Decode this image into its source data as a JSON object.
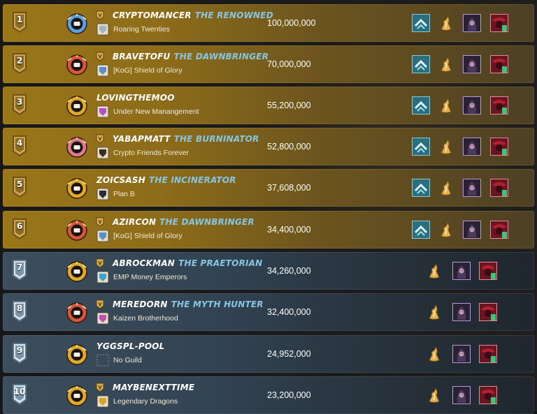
{
  "leaderboard": [
    {
      "rank": "1",
      "player": "CRYPTOMANCER",
      "title": "THE RENOWNED",
      "guild": "Roaring Twenties",
      "score": "100,000,000",
      "tier": "gold",
      "emblem": true,
      "has_title_icon": true
    },
    {
      "rank": "2",
      "player": "BRAVETOFU",
      "title": "THE DAWNBRINGER",
      "guild": "[KoG] Shield of Glory",
      "score": "70,000,000",
      "tier": "gold",
      "emblem": true,
      "has_title_icon": true
    },
    {
      "rank": "3",
      "player": "LOVINGTHEMOO",
      "title": "",
      "guild": "Under New Manangement",
      "score": "55,200,000",
      "tier": "gold",
      "emblem": true,
      "has_title_icon": false
    },
    {
      "rank": "4",
      "player": "YABAPMATT",
      "title": "THE BURNINATOR",
      "guild": "Crypto Friends Forever",
      "score": "52,800,000",
      "tier": "gold",
      "emblem": true,
      "has_title_icon": true
    },
    {
      "rank": "5",
      "player": "ZOICSASH",
      "title": "THE INCINERATOR",
      "guild": "Plan B",
      "score": "37,608,000",
      "tier": "gold",
      "emblem": true,
      "has_title_icon": false
    },
    {
      "rank": "6",
      "player": "AZIRCON",
      "title": "THE DAWNBRINGER",
      "guild": "[KoG] Shield of Glory",
      "score": "34,400,000",
      "tier": "gold",
      "emblem": true,
      "has_title_icon": true
    },
    {
      "rank": "7",
      "player": "ABROCKMAN",
      "title": "THE PRAETORIAN",
      "guild": "EMP Money Emperors",
      "score": "34,260,000",
      "tier": "silver",
      "emblem": false,
      "has_title_icon": true
    },
    {
      "rank": "8",
      "player": "MEREDORN",
      "title": "THE MYTH HUNTER",
      "guild": "Kaizen Brotherhood",
      "score": "32,400,000",
      "tier": "silver",
      "emblem": false,
      "has_title_icon": true
    },
    {
      "rank": "9",
      "player": "YGGSPL-POOL",
      "title": "",
      "guild": "No Guild",
      "score": "24,952,000",
      "tier": "silver",
      "emblem": false,
      "has_title_icon": false
    },
    {
      "rank": "10",
      "player": "MAYBENEXTTIME",
      "title": "",
      "guild": "Legendary Dragons",
      "score": "23,200,000",
      "tier": "silver",
      "emblem": false,
      "has_title_icon": true
    }
  ],
  "icons": {
    "rank_badge": "shield-badge-icon",
    "avatar": "player-avatar-icon",
    "title_badge": "title-badge-icon",
    "guild_crest": "guild-crest-icon",
    "reward_emblem": "chevron-emblem-icon",
    "reward_potion": "flame-potion-icon",
    "reward_card_dark": "hooded-monster-card-icon",
    "reward_card_red": "red-beast-card-icon"
  },
  "colors": {
    "gold_row": "#9a7619",
    "silver_row": "#3c4d5c",
    "title_text": "#86c6e2",
    "player_text": "#ffffff"
  }
}
